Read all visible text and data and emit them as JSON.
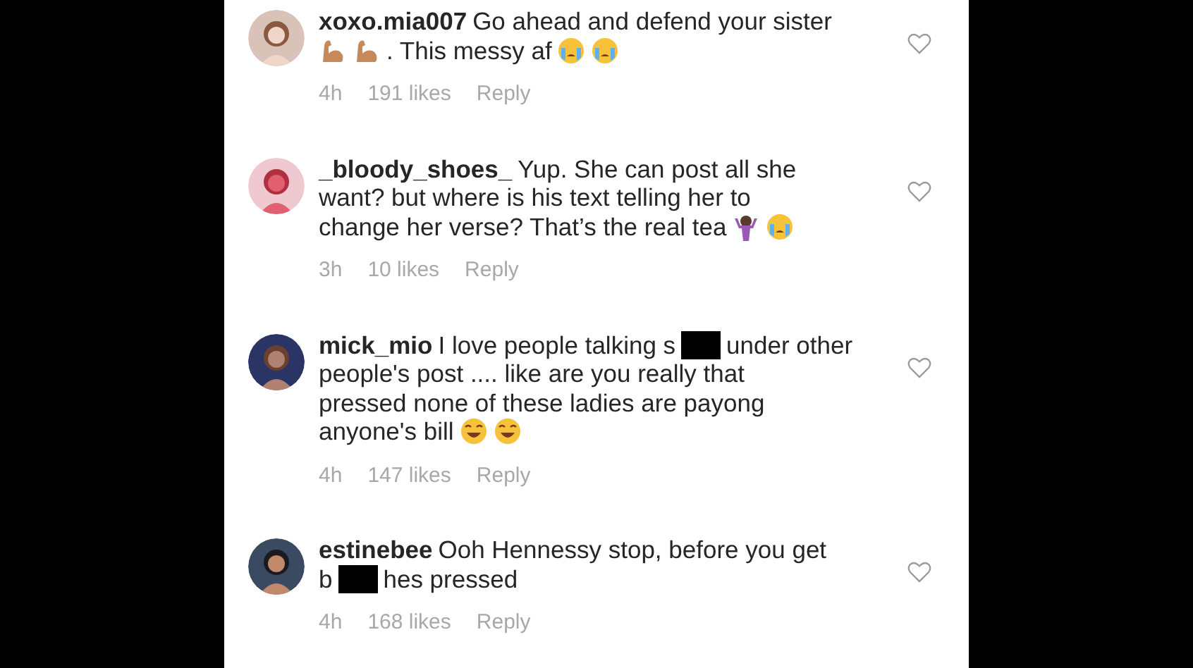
{
  "comments": [
    {
      "username": "xoxo.mia007",
      "lines": [
        [
          {
            "kind": "text",
            "text": "Go ahead and defend your sister"
          }
        ],
        [
          {
            "kind": "muscle_emoji"
          },
          {
            "kind": "muscle_emoji"
          },
          {
            "kind": "text",
            "text": ". This messy af"
          },
          {
            "kind": "crying_emoji"
          },
          {
            "kind": "crying_emoji"
          }
        ]
      ],
      "time": "4h",
      "likes": "191 likes",
      "reply": "Reply"
    },
    {
      "username": "_bloody_shoes_",
      "lines": [
        [
          {
            "kind": "text",
            "text": "Yup. She can post all she"
          }
        ],
        [
          {
            "kind": "text",
            "text": "want? but where is his text telling her to"
          }
        ],
        [
          {
            "kind": "text",
            "text": "change her verse? That’s the real tea"
          },
          {
            "kind": "shrug_emoji"
          },
          {
            "kind": "crying_emoji"
          }
        ]
      ],
      "time": "3h",
      "likes": "10 likes",
      "reply": "Reply"
    },
    {
      "username": "mick_mio",
      "lines": [
        [
          {
            "kind": "text",
            "text": "I love people talking s"
          },
          {
            "kind": "redacted"
          },
          {
            "kind": "text",
            "text": "under other"
          }
        ],
        [
          {
            "kind": "text",
            "text": "people's post .... like are you really that"
          }
        ],
        [
          {
            "kind": "text",
            "text": "pressed none of these ladies are payong"
          }
        ],
        [
          {
            "kind": "text",
            "text": "anyone's bill"
          },
          {
            "kind": "laughing_emoji"
          },
          {
            "kind": "laughing_emoji"
          }
        ]
      ],
      "time": "4h",
      "likes": "147 likes",
      "reply": "Reply"
    },
    {
      "username": "estinebee",
      "lines": [
        [
          {
            "kind": "text",
            "text": "Ooh Hennessy stop, before you get"
          }
        ],
        [
          {
            "kind": "text",
            "text": "b"
          },
          {
            "kind": "redacted"
          },
          {
            "kind": "text",
            "text": "hes pressed"
          }
        ]
      ],
      "time": "4h",
      "likes": "168 likes",
      "reply": "Reply"
    }
  ]
}
